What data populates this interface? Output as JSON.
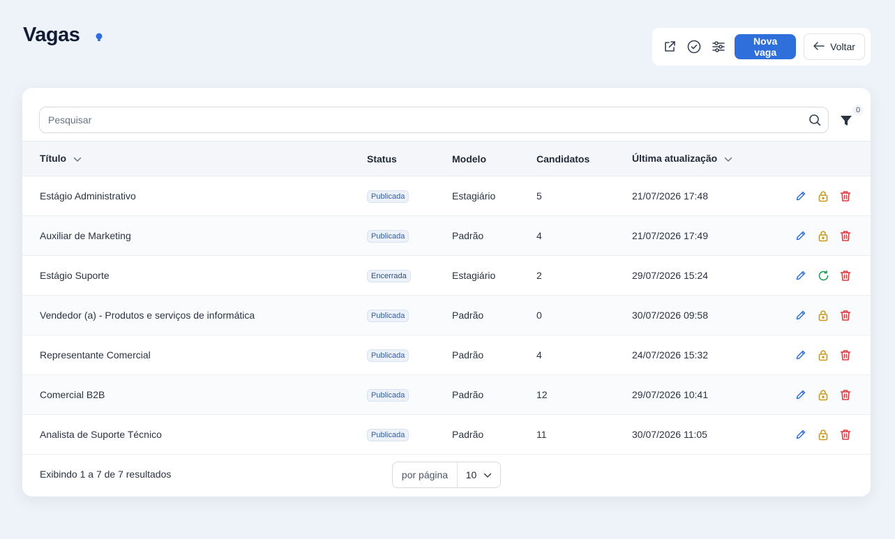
{
  "page": {
    "title": "Vagas"
  },
  "toolbar": {
    "new_label": "Nova vaga",
    "back_label": "Voltar"
  },
  "search": {
    "placeholder": "Pesquisar"
  },
  "filter": {
    "count": "0"
  },
  "table": {
    "columns": {
      "title": "Título",
      "status": "Status",
      "model": "Modelo",
      "candidates": "Candidatos",
      "updated": "Última atualização"
    },
    "rows": [
      {
        "title": "Estágio Administrativo",
        "status": "Publicada",
        "model": "Estagiário",
        "candidates": "5",
        "updated": "21/07/2026 17:48",
        "action": "lock"
      },
      {
        "title": "Auxiliar de Marketing",
        "status": "Publicada",
        "model": "Padrão",
        "candidates": "4",
        "updated": "21/07/2026 17:49",
        "action": "lock"
      },
      {
        "title": "Estágio Suporte",
        "status": "Encerrada",
        "model": "Estagiário",
        "candidates": "2",
        "updated": "29/07/2026 15:24",
        "action": "reopen"
      },
      {
        "title": "Vendedor (a) - Produtos e serviços de informática",
        "status": "Publicada",
        "model": "Padrão",
        "candidates": "0",
        "updated": "30/07/2026 09:58",
        "action": "lock"
      },
      {
        "title": "Representante Comercial",
        "status": "Publicada",
        "model": "Padrão",
        "candidates": "4",
        "updated": "24/07/2026 15:32",
        "action": "lock"
      },
      {
        "title": "Comercial B2B",
        "status": "Publicada",
        "model": "Padrão",
        "candidates": "12",
        "updated": "29/07/2026 10:41",
        "action": "lock"
      },
      {
        "title": "Analista de Suporte Técnico",
        "status": "Publicada",
        "model": "Padrão",
        "candidates": "11",
        "updated": "30/07/2026 11:05",
        "action": "lock"
      }
    ]
  },
  "footer": {
    "summary": "Exibindo 1 a 7 de 7 resultados",
    "per_page_label": "por página",
    "per_page_value": "10"
  },
  "colors": {
    "primary": "#2f6fdb",
    "edit": "#2f6fdb",
    "lock": "#c99a1a",
    "delete": "#e0393e",
    "reopen": "#1f9d55"
  }
}
